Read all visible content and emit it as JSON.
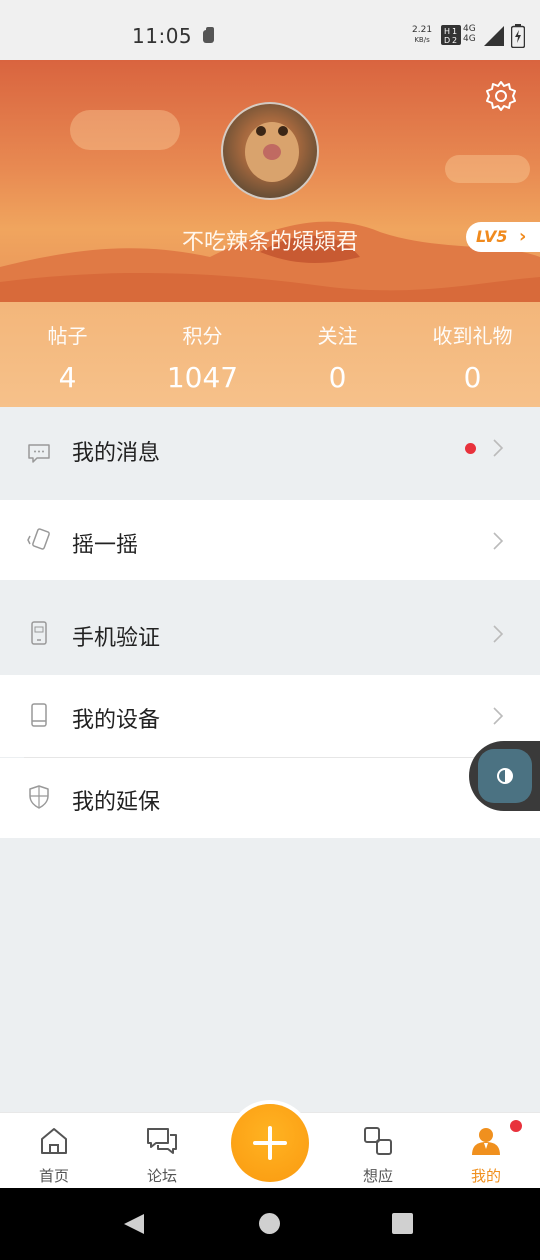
{
  "status_bar": {
    "time": "11:05",
    "net_speed": "2.21",
    "net_unit": "KB/s",
    "network_label_1": "4G",
    "network_label_2": "4G"
  },
  "profile": {
    "username": "不吃辣条的熲熲君",
    "level": "LV5",
    "settings_icon": "gear-icon",
    "avatar": "cat-avatar"
  },
  "stats": [
    {
      "label": "帖子",
      "value": "4"
    },
    {
      "label": "积分",
      "value": "1047"
    },
    {
      "label": "关注",
      "value": "0"
    },
    {
      "label": "收到礼物",
      "value": "0"
    }
  ],
  "menu": [
    {
      "label": "我的消息",
      "icon": "message-icon",
      "has_dot": true
    },
    {
      "label": "摇一摇",
      "icon": "shake-icon"
    },
    {
      "label": "手机验证",
      "icon": "phone-verify-icon"
    },
    {
      "label": "我的设备",
      "icon": "device-icon"
    },
    {
      "label": "我的延保",
      "icon": "shield-icon"
    }
  ],
  "bottom_nav": [
    {
      "label": "首页",
      "icon": "home-icon"
    },
    {
      "label": "论坛",
      "icon": "forum-icon"
    },
    {
      "label": "想应",
      "icon": "apps-icon"
    },
    {
      "label": "我的",
      "icon": "user-icon",
      "active": true
    }
  ],
  "colors": {
    "accent": "#f0901e",
    "badge": "#e8323c"
  }
}
